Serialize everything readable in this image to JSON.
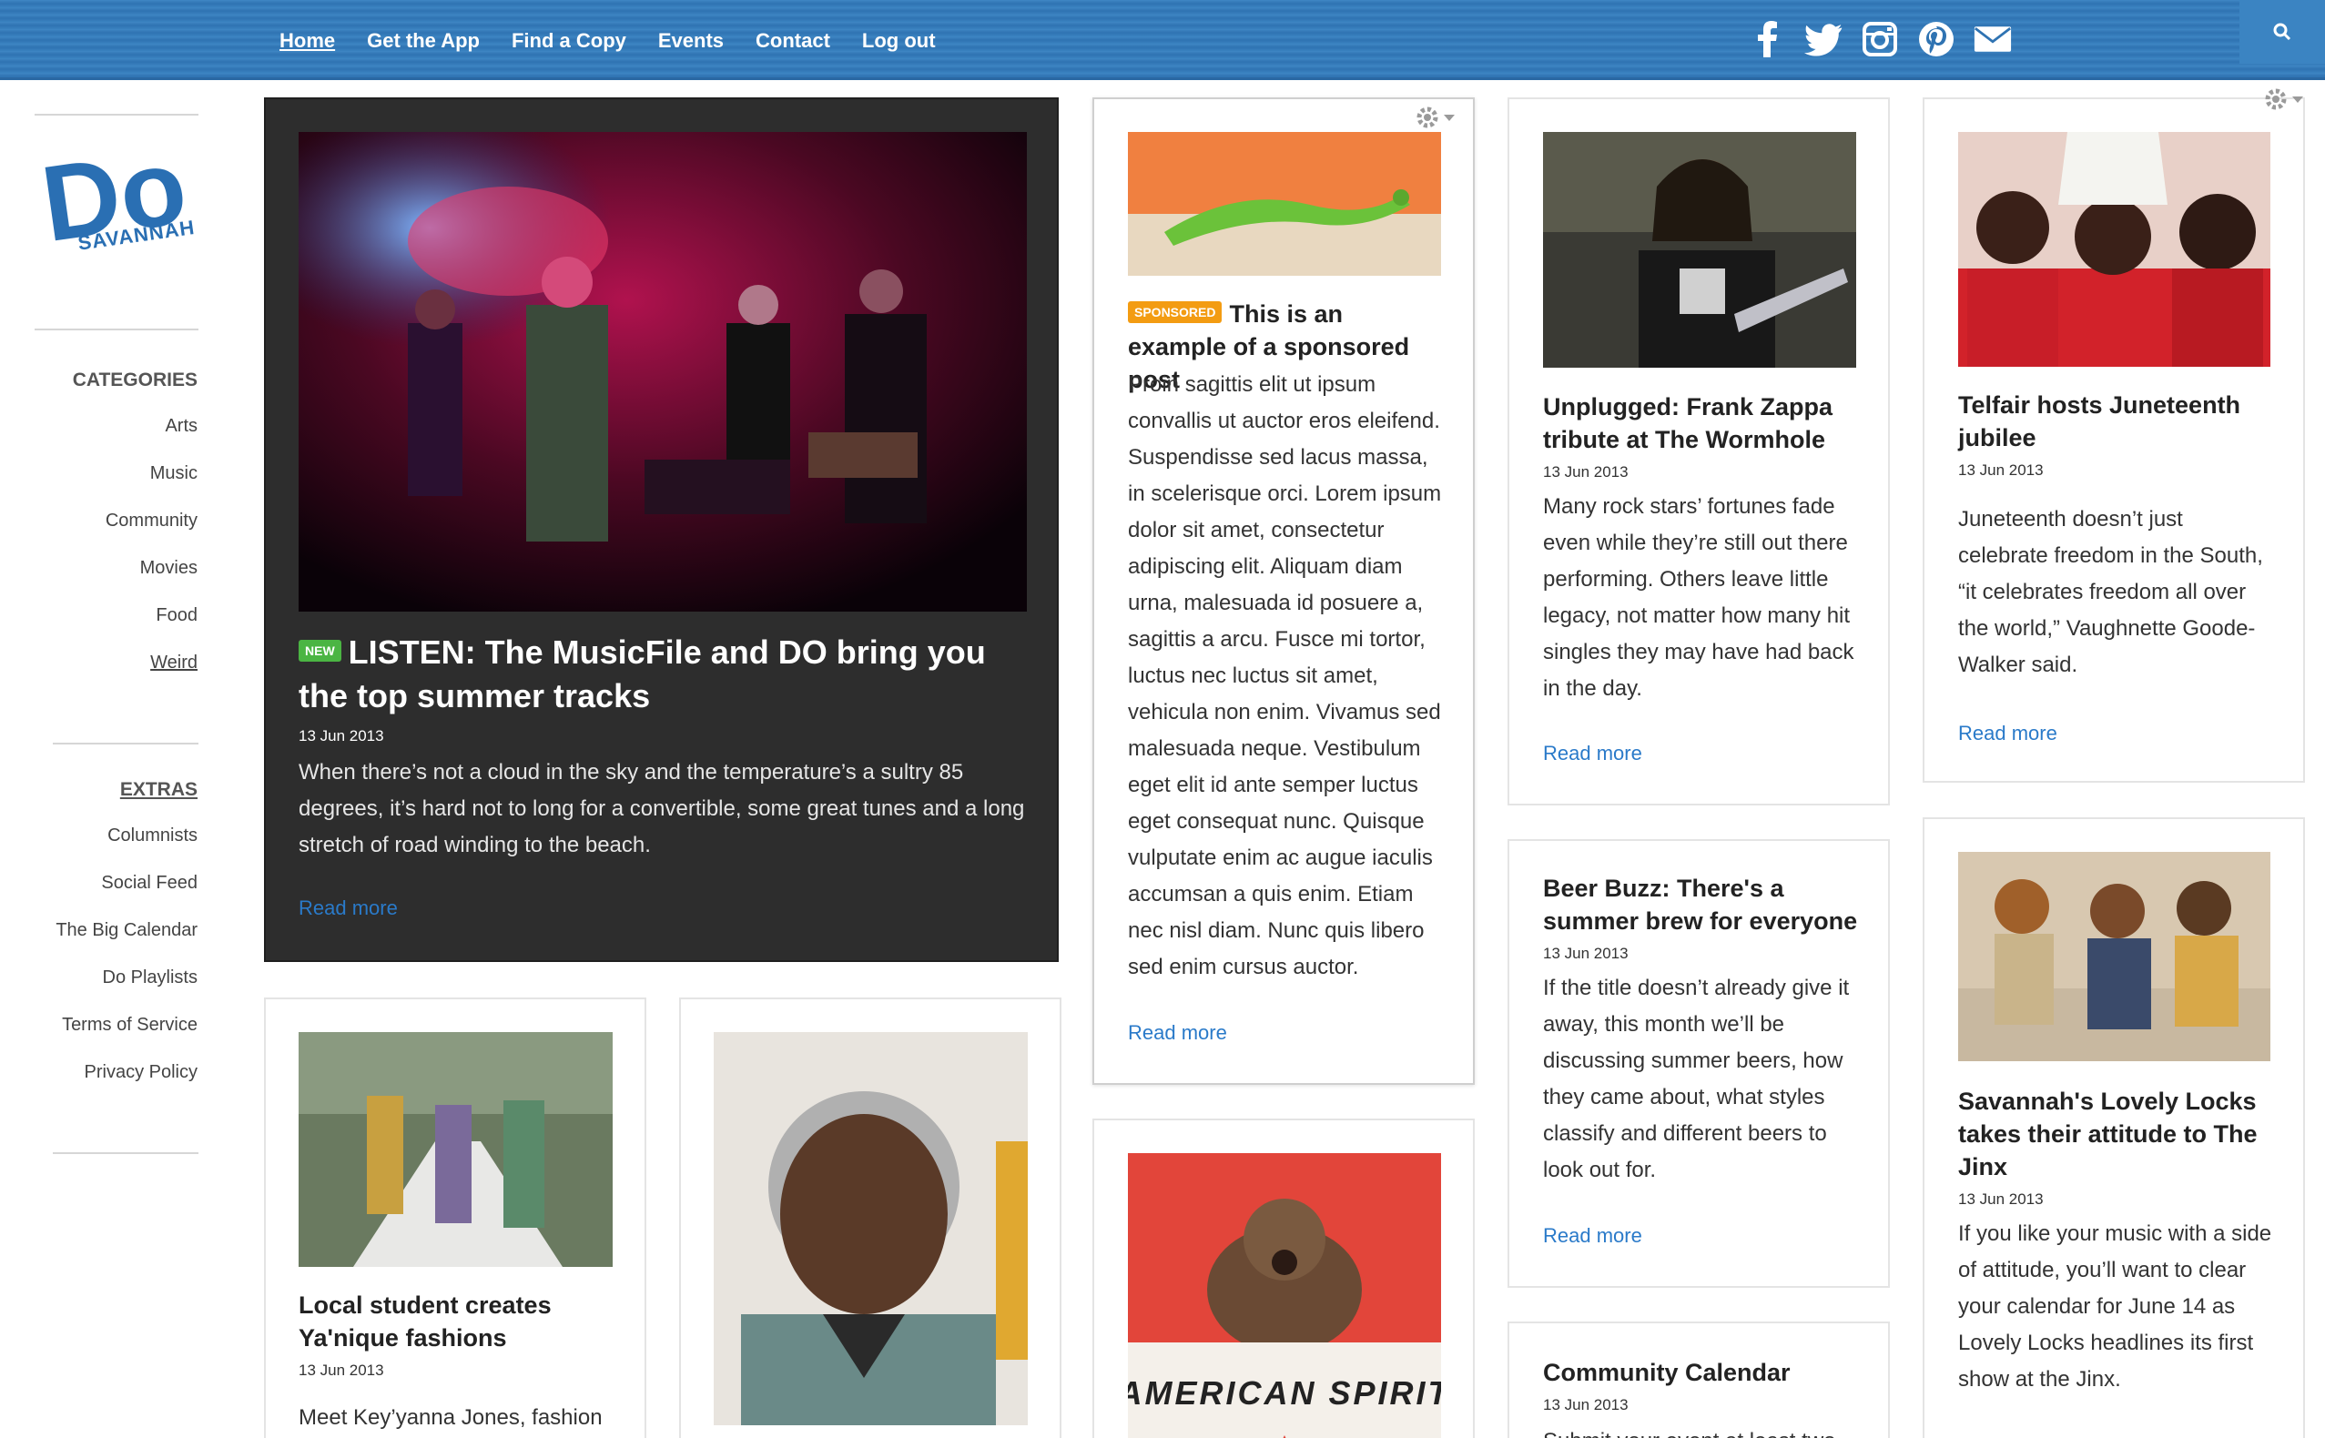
{
  "nav": {
    "items": [
      "Home",
      "Get the App",
      "Find a Copy",
      "Events",
      "Contact",
      "Log out"
    ],
    "active": "Home"
  },
  "social": [
    "facebook-icon",
    "twitter-icon",
    "instagram-icon",
    "pinterest-icon",
    "email-icon"
  ],
  "brand": {
    "logo_top": "Do",
    "logo_bottom": "SAVANNAH",
    "color": "#2a6fb3"
  },
  "sidebar": {
    "categories_heading": "CATEGORIES",
    "categories": [
      "Arts",
      "Music",
      "Community",
      "Movies",
      "Food",
      "Weird"
    ],
    "extras_heading": "EXTRAS",
    "extras": [
      "Columnists",
      "Social Feed",
      "The Big Calendar",
      "Do Playlists",
      "Terms of Service",
      "Privacy Policy"
    ]
  },
  "featured": {
    "badge": "NEW",
    "title": "LISTEN: The MusicFile and DO bring you the top summer tracks",
    "date": "13 Jun 2013",
    "excerpt": "When there’s not a cloud in the sky and the temperature’s a sultry 85 degrees, it’s hard not to long for a convertible, some great tunes and a long stretch of road winding to the beach.",
    "read_more": "Read more"
  },
  "sponsored": {
    "badge": "SPONSORED",
    "title": "This is an example of a sponsored post",
    "excerpt": "Proin sagittis elit ut ipsum convallis ut auctor eros eleifend. Suspendisse sed lacus massa, in scelerisque orci. Lorem ipsum dolor sit amet, consectetur adipiscing elit. Aliquam diam urna, malesuada id posuere a, sagittis a arcu. Fusce mi tortor, luctus nec luctus sit amet, vehicula non enim. Vivamus sed malesuada neque. Vestibulum eget elit id ante semper luctus eget consequat nunc. Quisque vulputate enim ac augue iaculis accumsan a quis enim. Etiam nec nisl diam. Nunc quis libero sed enim cursus auctor.",
    "read_more": "Read more"
  },
  "zappa": {
    "title": "Unplugged: Frank Zappa tribute at The Wormhole",
    "date": "13 Jun 2013",
    "excerpt": "Many rock stars’ fortunes fade even while they’re still out there performing. Others leave little legacy, not matter how many hit singles they may have had back in the day.",
    "read_more": "Read more"
  },
  "telfair": {
    "title": "Telfair hosts Juneteenth jubilee",
    "date": "13 Jun 2013",
    "excerpt": "Juneteenth doesn’t just celebrate freedom in the South, “it celebrates freedom all over the world,” Vaughnette Goode-Walker said.",
    "read_more": "Read more"
  },
  "beer": {
    "title": "Beer Buzz: There's a summer brew for everyone",
    "date": "13 Jun 2013",
    "excerpt": "If the title doesn’t already give it away, this month we’ll be discussing summer beers, how they came about, what styles classify and different beers to look out for.",
    "read_more": "Read more"
  },
  "locks": {
    "title": "Savannah's Lovely Locks takes their attitude to The Jinx",
    "date": "13 Jun 2013",
    "excerpt": "If you like your music with a side of attitude, you’ll want to clear your calendar for June 14 as Lovely Locks headlines its first show at the Jinx."
  },
  "fashion": {
    "title": "Local student creates Ya'nique fashions",
    "date": "13 Jun 2013",
    "excerpt": "Meet Key’yanna Jones, fashion"
  },
  "calendar": {
    "title": "Community Calendar",
    "date": "13 Jun 2013",
    "excerpt": "Submit your event at least two"
  },
  "american_spirit": {
    "poster_text": "AMERICAN SPIRIT"
  }
}
